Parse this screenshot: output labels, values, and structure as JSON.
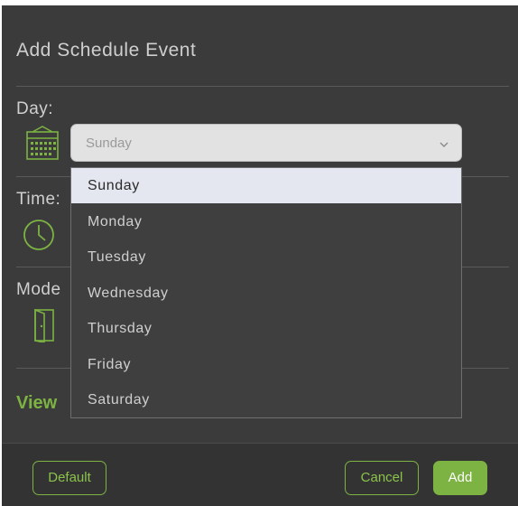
{
  "dialog": {
    "title": "Add Schedule Event"
  },
  "day": {
    "label": "Day:",
    "selected": "Sunday",
    "icon": "calendar-icon"
  },
  "time": {
    "label": "Time:",
    "icon": "clock-icon"
  },
  "mode": {
    "label": "Mode",
    "icon": "door-icon"
  },
  "view": {
    "label": "View"
  },
  "dropdown": {
    "options": [
      "Sunday",
      "Monday",
      "Tuesday",
      "Wednesday",
      "Thursday",
      "Friday",
      "Saturday"
    ],
    "highlighted": "Sunday"
  },
  "footer": {
    "default_label": "Default",
    "cancel_label": "Cancel",
    "add_label": "Add"
  },
  "colors": {
    "background": "#3b3b3b",
    "accent": "#7cb342",
    "highlight": "#e4e7ef"
  }
}
